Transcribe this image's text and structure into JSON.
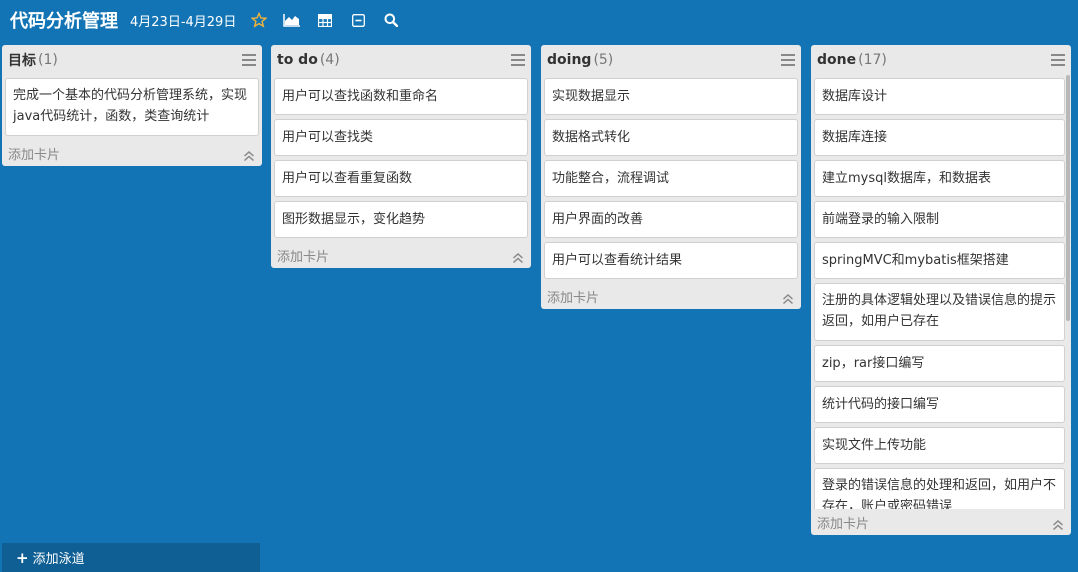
{
  "board": {
    "title": "代码分析管理",
    "dates": "4月23日-4月29日"
  },
  "toolbar": {
    "icons": [
      "star-icon",
      "chart-icon",
      "table-icon",
      "collapse-icon",
      "search-icon"
    ],
    "star_color": "#f0b43c"
  },
  "lists": [
    {
      "name": "目标",
      "count": "(1)",
      "cards": [
        "完成一个基本的代码分析管理系统，实现java代码统计，函数，类查询统计"
      ],
      "add_card": "添加卡片"
    },
    {
      "name": "to do",
      "count": "(4)",
      "cards": [
        "用户可以查找函数和重命名",
        "用户可以查找类",
        "用户可以查看重复函数",
        "图形数据显示，变化趋势"
      ],
      "add_card": "添加卡片"
    },
    {
      "name": "doing",
      "count": "(5)",
      "cards": [
        "实现数据显示",
        "数据格式转化",
        "功能整合，流程调试",
        "用户界面的改善",
        "用户可以查看统计结果"
      ],
      "add_card": "添加卡片"
    },
    {
      "name": "done",
      "count": "(17)",
      "cards": [
        "数据库设计",
        "数据库连接",
        "建立mysql数据库，和数据表",
        "前端登录的输入限制",
        "springMVC和mybatis框架搭建",
        "注册的具体逻辑处理以及错误信息的提示返回，如用户已存在",
        "zip，rar接口编写",
        "统计代码的接口编写",
        "实现文件上传功能",
        "登录的错误信息的处理和返回，如用户不存在，账户或密码错误"
      ],
      "add_card": "添加卡片"
    }
  ],
  "footer": {
    "add_lane": "添加泳道"
  }
}
